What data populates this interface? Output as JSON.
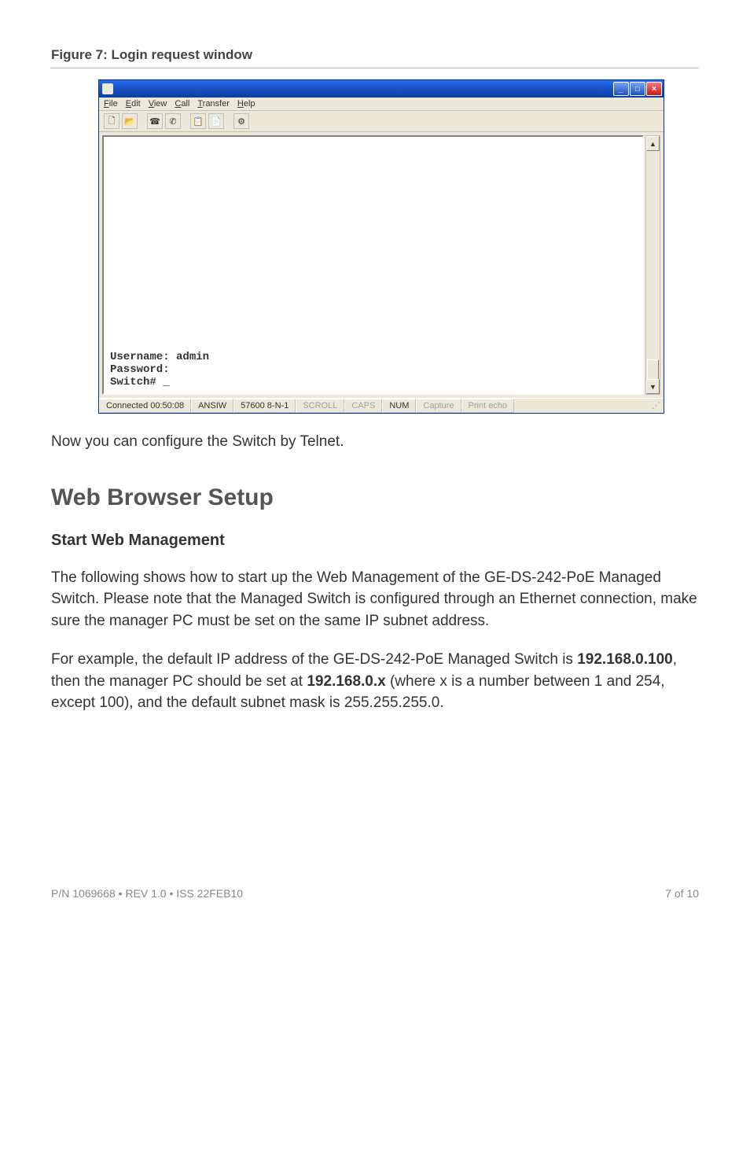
{
  "caption": "Figure 7: Login request window",
  "window": {
    "menus": {
      "file": "File",
      "edit": "Edit",
      "view": "View",
      "call": "Call",
      "transfer": "Transfer",
      "help": "Help"
    },
    "terminal": {
      "line1": "Username: admin",
      "line2": "Password:",
      "line3": "Switch# _"
    },
    "status": {
      "connected": "Connected 00:50:08",
      "emulation": "ANSIW",
      "settings": "57600 8-N-1",
      "scroll": "SCROLL",
      "caps": "CAPS",
      "num": "NUM",
      "capture": "Capture",
      "printecho": "Print echo"
    }
  },
  "text": {
    "after_figure": "Now you can configure the Switch by Telnet.",
    "h2": "Web Browser Setup",
    "h3": "Start Web Management",
    "p1": "The following shows how to start up the Web Management of the GE-DS-242-PoE Managed Switch. Please note that the Managed Switch is configured through an Ethernet connection, make sure the manager PC must be set on the same IP subnet address.",
    "p2_a": "For example, the default IP address of the GE-DS-242-PoE Managed Switch is ",
    "p2_b": "192.168.0.100",
    "p2_c": ", then the manager PC should be set at ",
    "p2_d": "192.168.0.x",
    "p2_e": " (where x is a number between 1 and 254, except 100), and the default subnet mask is 255.255.255.0."
  },
  "footer": {
    "left": "P/N 1069668 • REV 1.0 • ISS 22FEB10",
    "right": "7 of 10"
  }
}
